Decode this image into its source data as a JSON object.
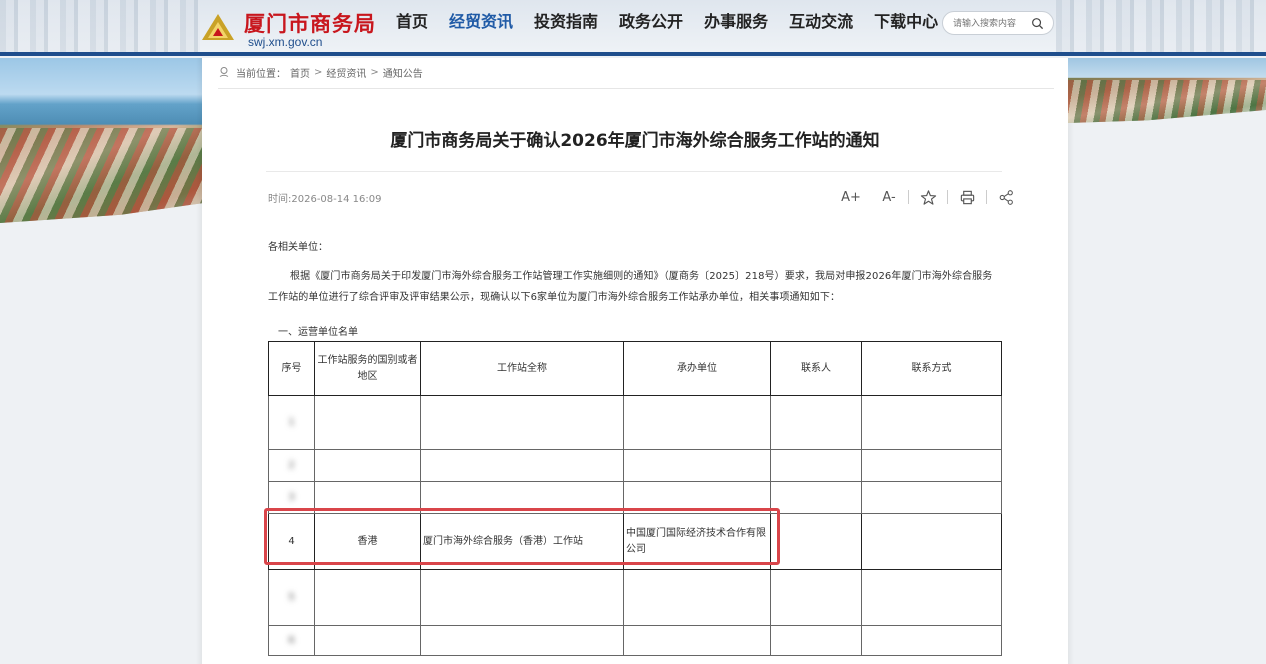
{
  "site": {
    "title": "厦门市商务局",
    "url": "swj.xm.gov.cn",
    "colors": {
      "brand_red": "#c8161d",
      "nav_blue": "#1f5aa6",
      "highlight_red": "#d9454a"
    }
  },
  "nav": {
    "items": [
      "首页",
      "经贸资讯",
      "投资指南",
      "政务公开",
      "办事服务",
      "互动交流",
      "下载中心"
    ],
    "active": "经贸资讯"
  },
  "search": {
    "placeholder": "请输入搜索内容",
    "icon": "search-icon"
  },
  "breadcrumb": {
    "label": "当前位置：",
    "items": [
      "首页",
      "经贸资讯",
      "通知公告"
    ],
    "separator": ">"
  },
  "article": {
    "title": "厦门市商务局关于确认2026年厦门市海外综合服务工作站的通知",
    "time": "时间:2026-08-14 16:09",
    "tools": {
      "font_increase": "A+",
      "font_decrease": "A-",
      "icons": [
        "star-icon",
        "print-icon",
        "share-icon"
      ]
    },
    "salutation": "各相关单位：",
    "paragraph": "根据《厦门市商务局关于印发厦门市海外综合服务工作站管理工作实施细则的通知》（厦商务〔2025〕218号）要求，我局对申报2026年厦门市海外综合服务工作站的单位进行了综合评审及评审结果公示，现确认以下6家单位为厦门市海外综合服务工作站承办单位，相关事项通知如下：",
    "section_heading": "一、运营单位名单"
  },
  "table": {
    "headers": [
      "序号",
      "工作站服务的国别或者地区",
      "工作站全称",
      "承办单位",
      "联系人",
      "联系方式"
    ],
    "rows": [
      [
        "1",
        "",
        "",
        "",
        "",
        ""
      ],
      [
        "2",
        "",
        "",
        "",
        "",
        ""
      ],
      [
        "3",
        "",
        "",
        "",
        "",
        ""
      ],
      [
        "4",
        "香港",
        "厦门市海外综合服务（香港）工作站",
        "中国厦门国际经济技术合作有限公司",
        "",
        ""
      ],
      [
        "5",
        "",
        "",
        "",
        "",
        ""
      ],
      [
        "6",
        "",
        "",
        "",
        "",
        ""
      ]
    ]
  }
}
